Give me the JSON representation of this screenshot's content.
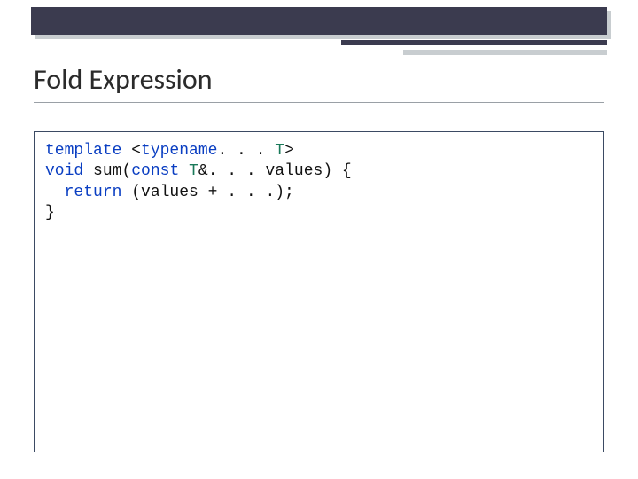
{
  "title": "Fold Expression",
  "code": {
    "kw_template": "template",
    "angle_open": " <",
    "kw_typename": "typename",
    "tmpl_rest": ". . . ",
    "type_T": "T",
    "angle_close": ">",
    "kw_void": "void",
    "space1": " ",
    "fn_name": "sum",
    "paren_open": "(",
    "kw_const": "const",
    "space2": " ",
    "type_T2": "T",
    "params_rest": "&. . . values) {",
    "indent": "  ",
    "kw_return": "return",
    "ret_rest": " (values + . . .);",
    "brace_close": "}"
  }
}
